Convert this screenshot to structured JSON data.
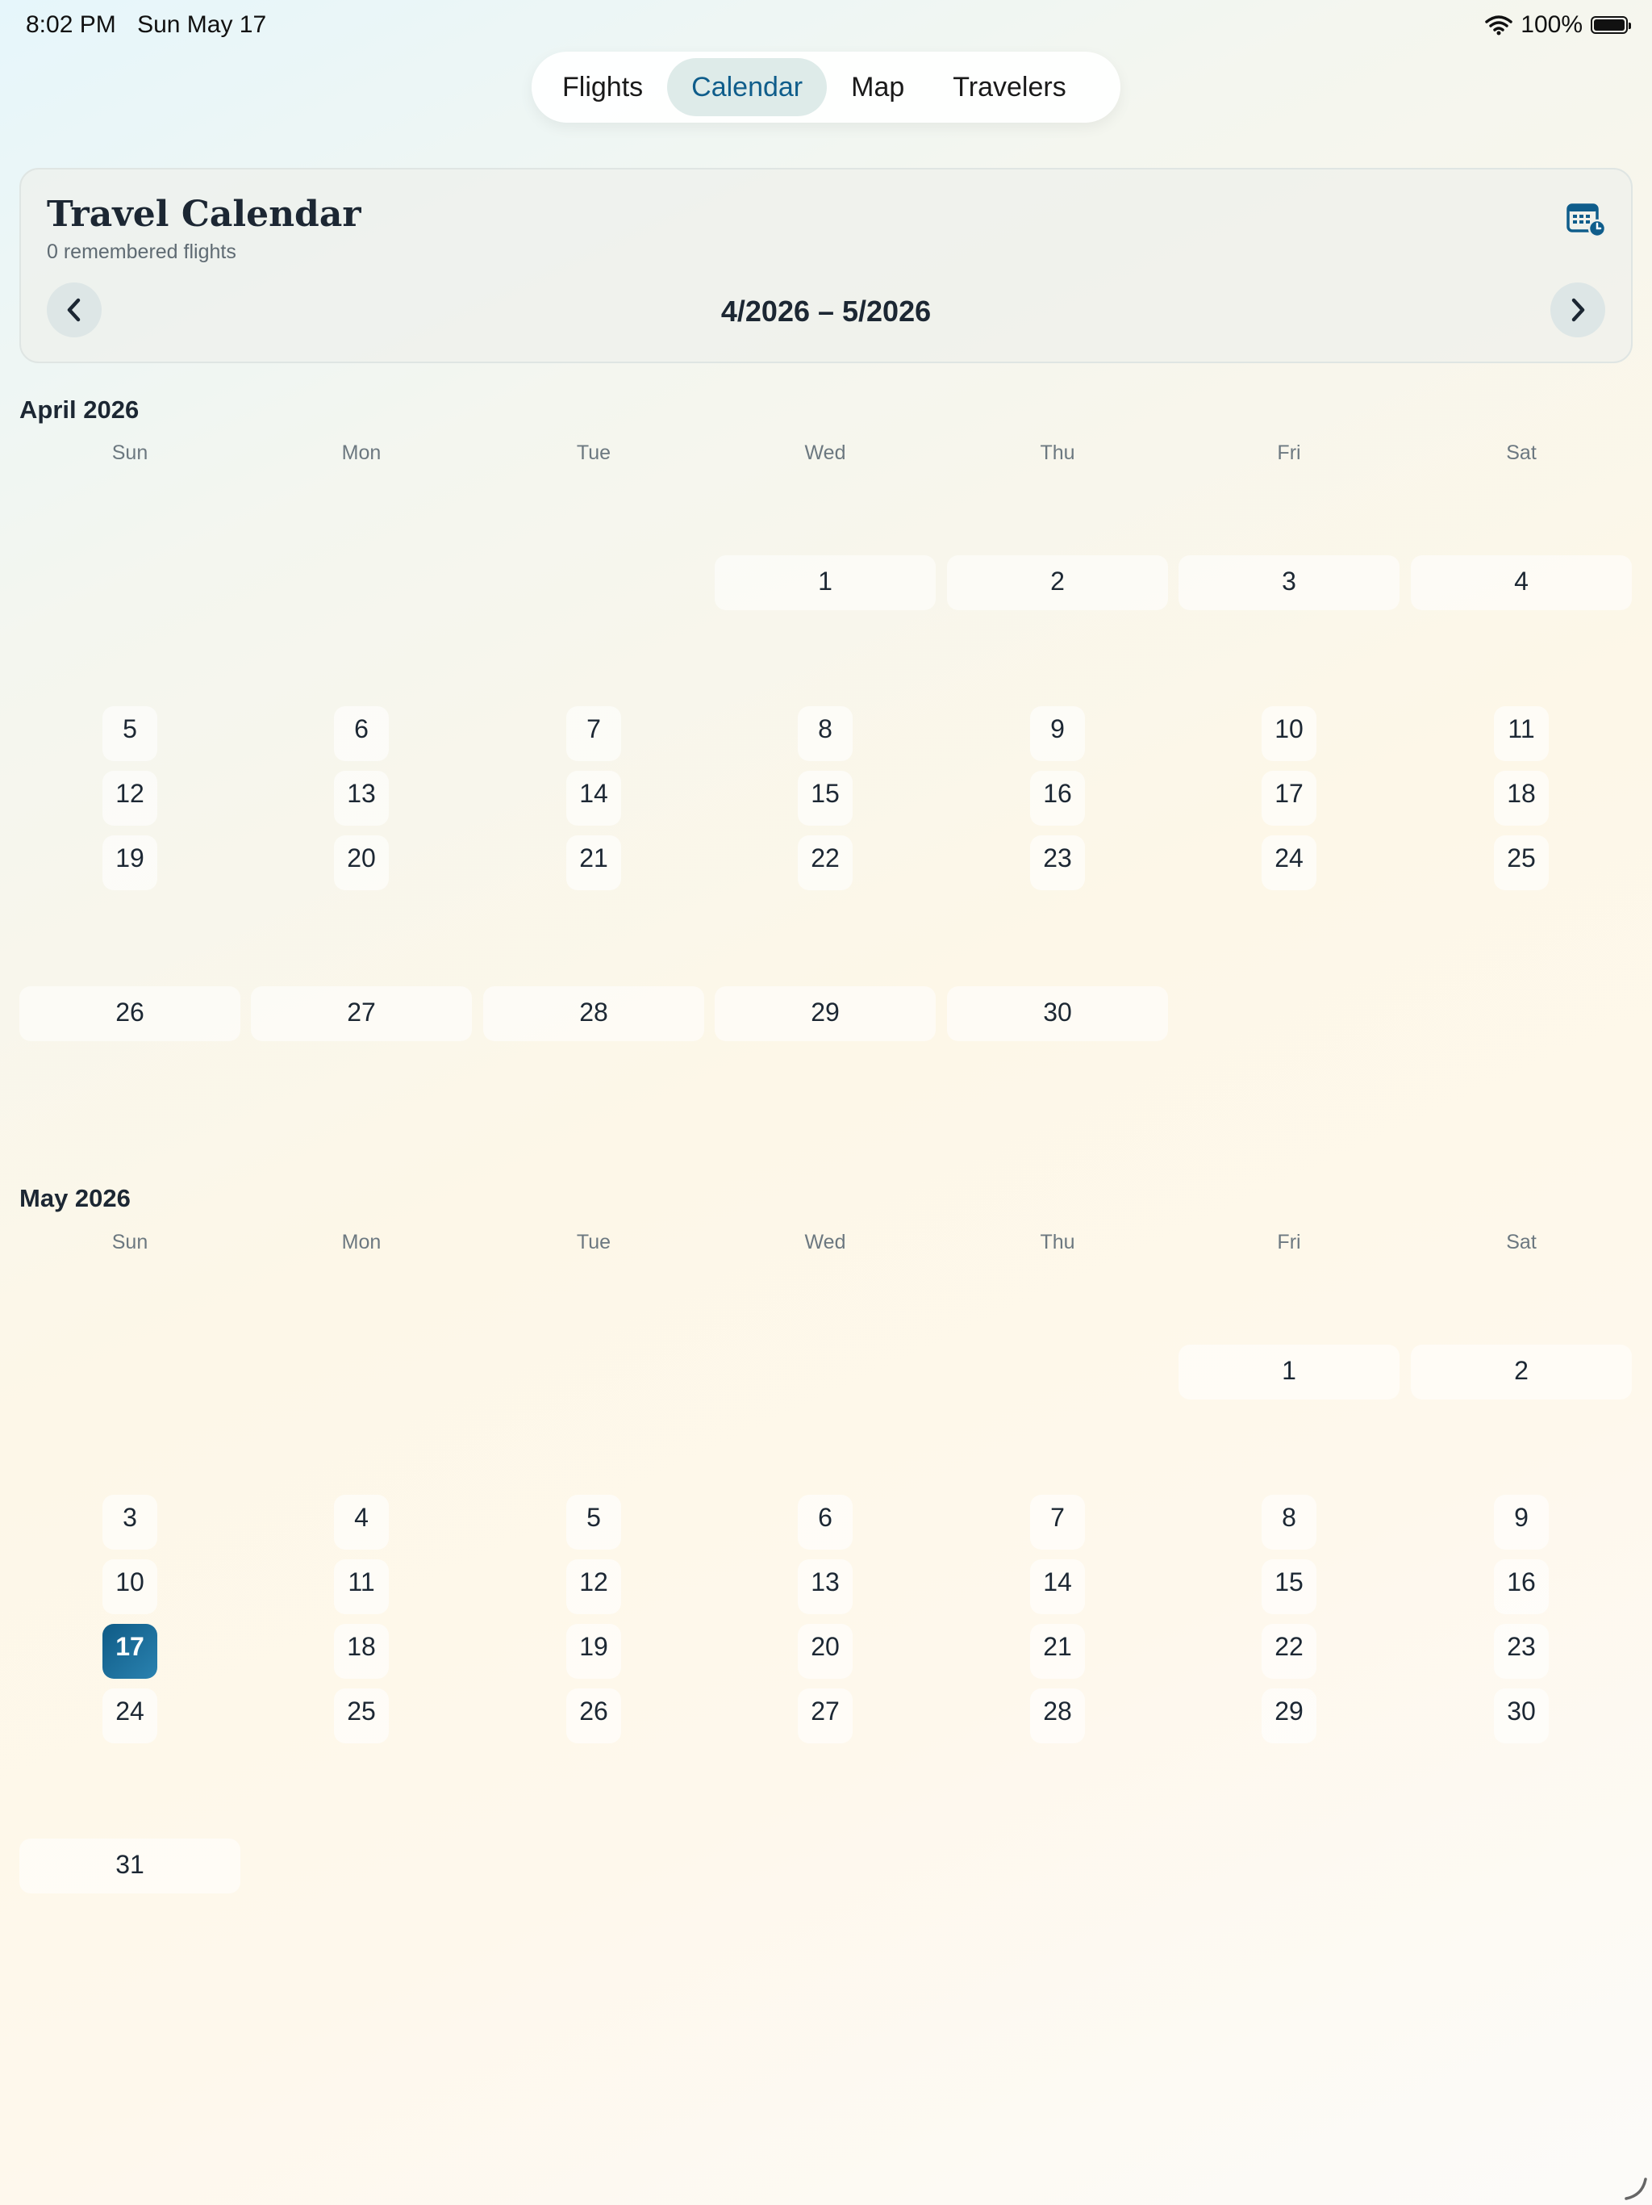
{
  "status_bar": {
    "time": "8:02 PM",
    "date": "Sun May 17",
    "battery": "100%",
    "battery_level": 1.0
  },
  "tabs": [
    {
      "label": "Flights",
      "active": false
    },
    {
      "label": "Calendar",
      "active": true
    },
    {
      "label": "Map",
      "active": false
    },
    {
      "label": "Travelers",
      "active": false
    }
  ],
  "header": {
    "title": "Travel Calendar",
    "subtitle": "0 remembered flights",
    "range": "4/2026 – 5/2026",
    "icons": {
      "calendar": "calendar-clock-icon",
      "prev": "chevron-left-icon",
      "next": "chevron-right-icon"
    }
  },
  "colors": {
    "accent": "#0f5d8b",
    "today": "#1a6f9e",
    "text": "#1c2733"
  },
  "weekdays": [
    "Sun",
    "Mon",
    "Tue",
    "Wed",
    "Thu",
    "Fri",
    "Sat"
  ],
  "months": [
    {
      "title": "April 2026",
      "weeks": [
        [
          null,
          null,
          null,
          "1",
          "2",
          "3",
          "4"
        ],
        [
          "5",
          "6",
          "7",
          "8",
          "9",
          "10",
          "11"
        ],
        [
          "12",
          "13",
          "14",
          "15",
          "16",
          "17",
          "18"
        ],
        [
          "19",
          "20",
          "21",
          "22",
          "23",
          "24",
          "25"
        ],
        [
          "26",
          "27",
          "28",
          "29",
          "30",
          null,
          null
        ]
      ]
    },
    {
      "title": "May 2026",
      "today": "17",
      "weeks": [
        [
          null,
          null,
          null,
          null,
          null,
          "1",
          "2"
        ],
        [
          "3",
          "4",
          "5",
          "6",
          "7",
          "8",
          "9"
        ],
        [
          "10",
          "11",
          "12",
          "13",
          "14",
          "15",
          "16"
        ],
        [
          "17",
          "18",
          "19",
          "20",
          "21",
          "22",
          "23"
        ],
        [
          "24",
          "25",
          "26",
          "27",
          "28",
          "29",
          "30"
        ],
        [
          "31",
          null,
          null,
          null,
          null,
          null,
          null
        ]
      ]
    }
  ]
}
